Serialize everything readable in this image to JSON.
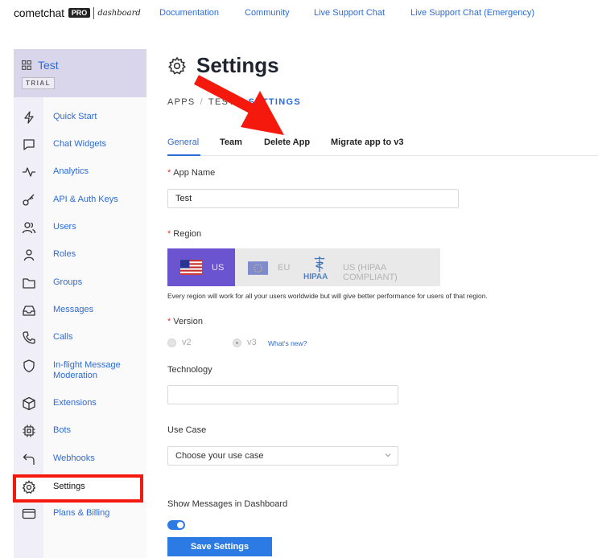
{
  "topbar": {
    "logo_text": "cometchat",
    "logo_badge": "PRO",
    "logo_suffix": "dashboard",
    "links": [
      "Documentation",
      "Community",
      "Live Support Chat",
      "Live Support Chat (Emergency)"
    ]
  },
  "sidebar": {
    "app_name": "Test",
    "plan_badge": "TRIAL",
    "items": [
      {
        "label": "Quick Start",
        "icon": "lightning-icon"
      },
      {
        "label": "Chat Widgets",
        "icon": "chat-bubble-icon"
      },
      {
        "label": "Analytics",
        "icon": "pulse-icon"
      },
      {
        "label": "API & Auth Keys",
        "icon": "key-icon"
      },
      {
        "label": "Users",
        "icon": "users-icon"
      },
      {
        "label": "Roles",
        "icon": "user-icon"
      },
      {
        "label": "Groups",
        "icon": "folder-icon"
      },
      {
        "label": "Messages",
        "icon": "inbox-icon"
      },
      {
        "label": "Calls",
        "icon": "phone-icon"
      },
      {
        "label": "In-flight Message Moderation",
        "icon": "shield-icon"
      },
      {
        "label": "Extensions",
        "icon": "cube-icon"
      },
      {
        "label": "Bots",
        "icon": "chip-icon"
      },
      {
        "label": "Webhooks",
        "icon": "return-arrow-icon"
      },
      {
        "label": "Settings",
        "icon": "gear-icon"
      },
      {
        "label": "Plans & Billing",
        "icon": "credit-card-icon"
      }
    ],
    "active_item": "Settings"
  },
  "page": {
    "title": "Settings",
    "breadcrumb": [
      "APPS",
      "TEST",
      "SETTINGS"
    ]
  },
  "tabs": [
    {
      "label": "General",
      "active": true
    },
    {
      "label": "Team"
    },
    {
      "label": "Delete App"
    },
    {
      "label": "Migrate app to v3"
    }
  ],
  "form": {
    "app_name_label": "App Name",
    "app_name_value": "Test",
    "region_label": "Region",
    "regions": [
      {
        "label": "US",
        "selected": true
      },
      {
        "label": "EU"
      },
      {
        "label": "US (HIPAA COMPLIANT)",
        "logo_text": "HIPAA"
      }
    ],
    "region_note": "Every region will work for all your users worldwide but will give better performance for users of that region.",
    "version_label": "Version",
    "versions": [
      {
        "label": "v2",
        "selected": false
      },
      {
        "label": "v3",
        "selected": true
      }
    ],
    "whats_new": "What's new?",
    "technology_label": "Technology",
    "technology_value": "",
    "use_case_label": "Use Case",
    "use_case_placeholder": "Choose your use case",
    "show_messages_label": "Show Messages in Dashboard",
    "show_messages_enabled": true,
    "save_label": "Save Settings"
  },
  "colors": {
    "accent": "#2c6bd6",
    "button": "#2c7be5",
    "region_selected": "#6a54cf",
    "annotation_red": "#f5190d"
  }
}
